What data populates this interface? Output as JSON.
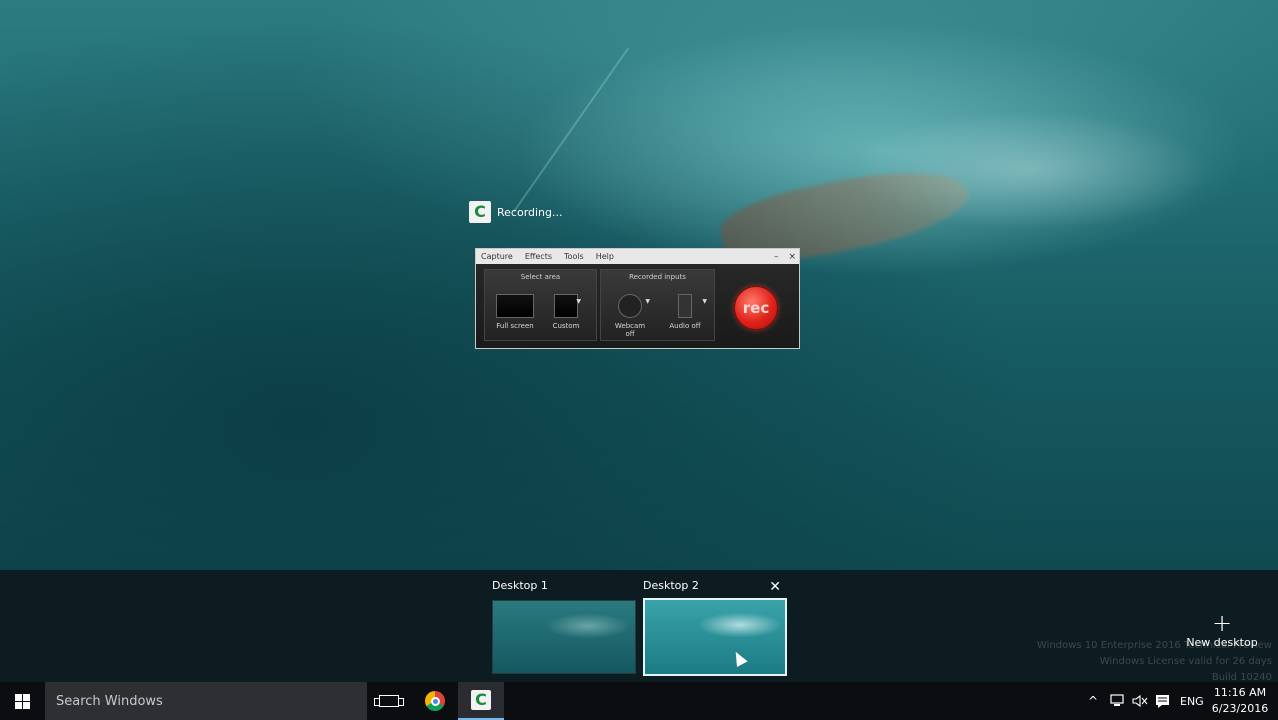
{
  "notification": {
    "text": "Recording...",
    "app_icon": "camtasia-icon",
    "logo_letter": "C"
  },
  "recorder": {
    "menu": [
      "Capture",
      "Effects",
      "Tools",
      "Help"
    ],
    "minimize": "–",
    "close": "×",
    "select_area_title": "Select area",
    "full_screen_label": "Full screen",
    "custom_label": "Custom",
    "recorded_inputs_title": "Recorded inputs",
    "webcam_label": "Webcam off",
    "audio_label": "Audio off",
    "dropdown_arrow": "▼",
    "rec_label": "rec",
    "rec_color": "#e0231a"
  },
  "taskview": {
    "desktops": [
      {
        "label": "Desktop 1",
        "active": false
      },
      {
        "label": "Desktop 2",
        "active": true
      }
    ],
    "close_glyph": "✕",
    "new_desktop_plus": "+",
    "new_desktop_label": "New desktop",
    "watermark": [
      "Windows 10 Enterprise 2016 Technical Preview",
      "Windows License valid for 26 days",
      "Build 10240"
    ]
  },
  "taskbar": {
    "search_placeholder": "Search Windows",
    "camtasia_letter": "C",
    "tray": {
      "chevron": "^",
      "language": "ENG"
    },
    "clock": {
      "time": "11:16 AM",
      "date": "6/23/2016"
    },
    "accent": "#76b9ed"
  }
}
